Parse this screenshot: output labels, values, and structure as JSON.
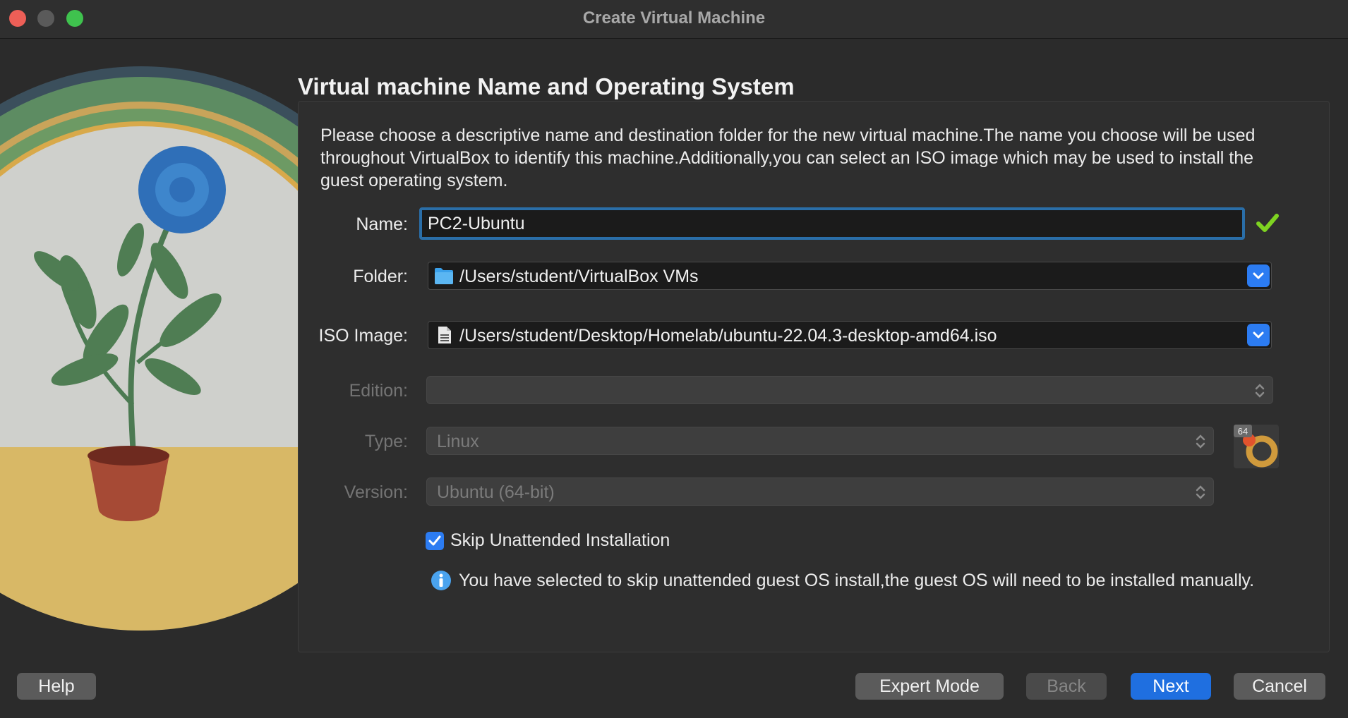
{
  "window": {
    "title": "Create Virtual Machine"
  },
  "page": {
    "heading": "Virtual machine Name and Operating System",
    "description": "Please choose a descriptive name and destination folder for the new virtual machine.The name you choose will be used throughout VirtualBox to identify this machine.Additionally,you can select an ISO image which may be used to install the guest operating system."
  },
  "form": {
    "name_label": "Name:",
    "name_value": "PC2-Ubuntu",
    "folder_label": "Folder:",
    "folder_value": "/Users/student/VirtualBox VMs",
    "iso_label": "ISO Image:",
    "iso_value": "/Users/student/Desktop/Homelab/ubuntu-22.04.3-desktop-amd64.iso",
    "edition_label": "Edition:",
    "edition_value": "",
    "type_label": "Type:",
    "type_value": "Linux",
    "version_label": "Version:",
    "version_value": "Ubuntu (64-bit)",
    "os_badge": "64",
    "skip_label": "Skip Unattended Installation",
    "skip_checked": true,
    "info_text": "You have selected to skip unattended guest OS install,the guest OS will need to be installed manually."
  },
  "buttons": {
    "help": "Help",
    "expert": "Expert Mode",
    "back": "Back",
    "next": "Next",
    "cancel": "Cancel"
  },
  "colors": {
    "accent": "#2c7cf2",
    "focus_ring": "#2a6ea8",
    "valid_check": "#7ed321",
    "close": "#ed5f57",
    "maximize": "#3fc24e"
  },
  "icons": [
    "folder-icon",
    "iso-file-icon",
    "check-valid-icon",
    "chevron-down-icon",
    "updown-arrows-icon",
    "ubuntu-os-icon",
    "info-icon"
  ]
}
